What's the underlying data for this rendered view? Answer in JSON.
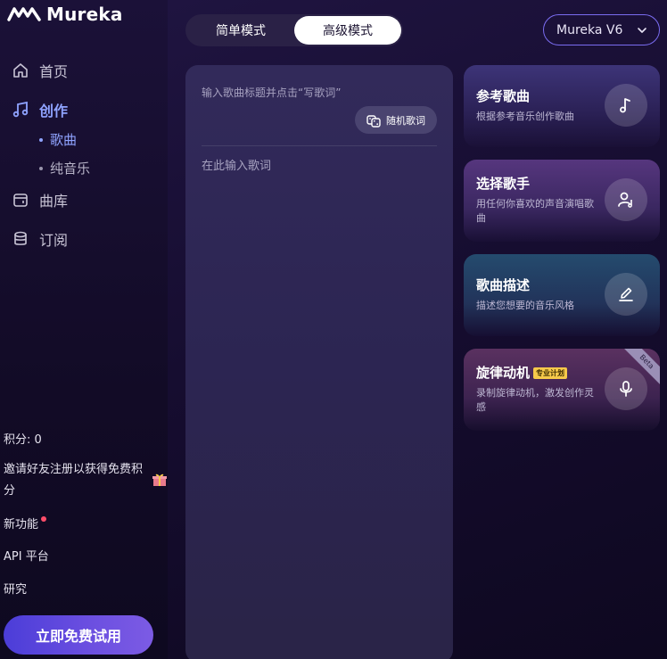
{
  "app": {
    "name": "Mureka"
  },
  "nav": {
    "home": "首页",
    "create": "创作",
    "sub_song": "歌曲",
    "sub_instrumental": "纯音乐",
    "library": "曲库",
    "subscribe": "订阅"
  },
  "sidebar_footer": {
    "points": "积分: 0",
    "invite": "邀请好友注册以获得免费积分",
    "new_features": "新功能",
    "api": "API 平台",
    "research": "研究",
    "cta": "立即免费试用"
  },
  "header": {
    "mode_simple": "简单模式",
    "mode_advanced": "高级模式",
    "selected_mode": "高级模式",
    "version": "Mureka V6"
  },
  "editor": {
    "title_placeholder": "输入歌曲标题并点击“写歌词”",
    "random_lyrics": "随机歌词",
    "lyrics_placeholder": "在此输入歌词"
  },
  "cards": [
    {
      "title": "参考歌曲",
      "desc": "根据参考音乐创作歌曲",
      "icon": "music-note-icon"
    },
    {
      "title": "选择歌手",
      "desc": "用任何你喜欢的声音演唱歌曲",
      "icon": "singer-icon"
    },
    {
      "title": "歌曲描述",
      "desc": "描述您想要的音乐风格",
      "icon": "pen-icon"
    },
    {
      "title": "旋律动机",
      "desc": "录制旋律动机，激发创作灵感",
      "icon": "microphone-icon",
      "badge": "专业计划",
      "ribbon": "Beta"
    }
  ],
  "colors": {
    "accent": "#8fa3ff",
    "cta_start": "#4b3dd8",
    "cta_end": "#7c5be4",
    "new_dot": "#ff4d6a",
    "pro_badge": "#f6c94a"
  }
}
